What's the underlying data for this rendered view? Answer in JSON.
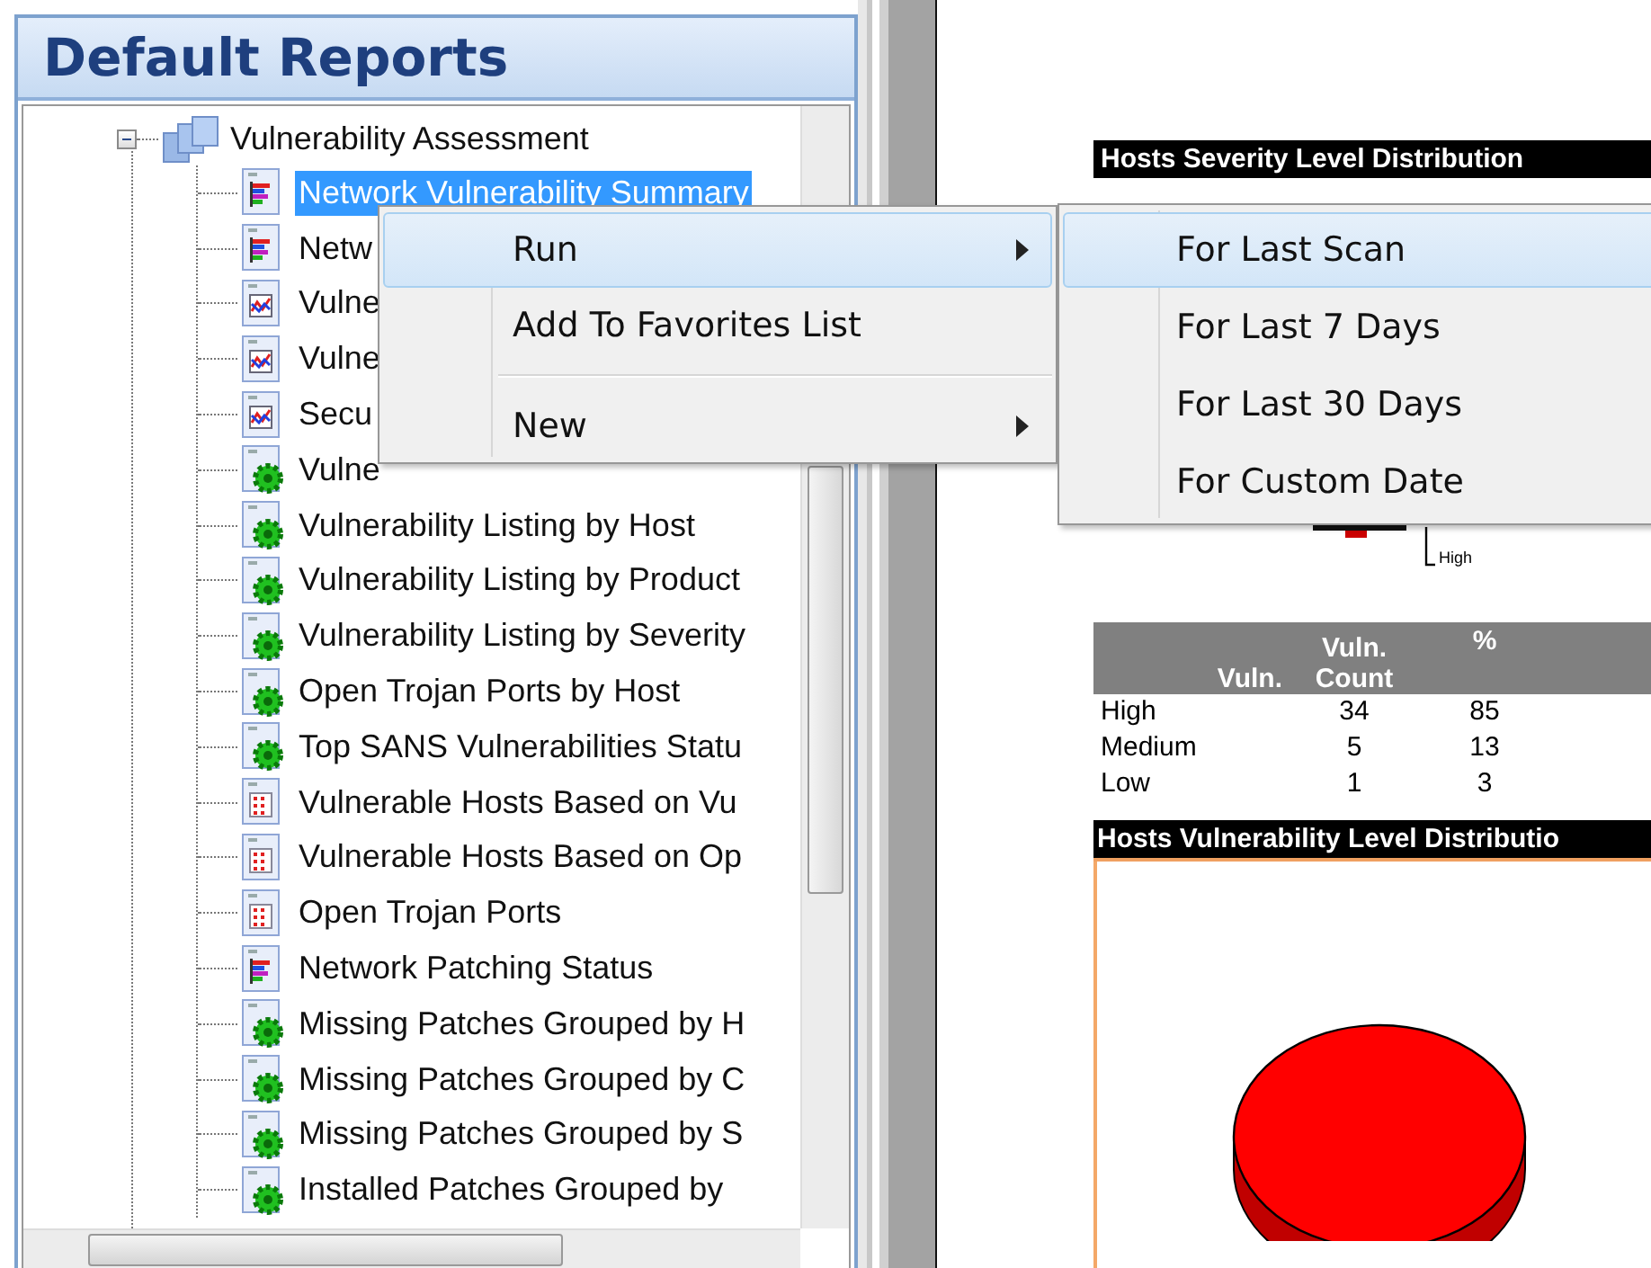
{
  "panel": {
    "title": "Default Reports"
  },
  "tree": {
    "label": "Vulnerability Assessment",
    "expanded": true,
    "children": [
      {
        "label": "Network Vulnerability Summary",
        "kind": "bars",
        "selected": true
      },
      {
        "label": "Netw",
        "kind": "bars",
        "selected": false
      },
      {
        "label": "Vulne",
        "kind": "line",
        "selected": false
      },
      {
        "label": "Vulne",
        "kind": "line",
        "selected": false
      },
      {
        "label": "Secu",
        "kind": "line",
        "selected": false
      },
      {
        "label": "Vulne",
        "kind": "gear",
        "selected": false
      },
      {
        "label": "Vulnerability Listing by Host",
        "kind": "gear",
        "selected": false
      },
      {
        "label": "Vulnerability Listing by Product",
        "kind": "gear",
        "selected": false
      },
      {
        "label": "Vulnerability Listing by Severity",
        "kind": "gear",
        "selected": false
      },
      {
        "label": "Open Trojan Ports by Host",
        "kind": "gear",
        "selected": false
      },
      {
        "label": "Top SANS Vulnerabilities Statu",
        "kind": "gear",
        "selected": false
      },
      {
        "label": "Vulnerable Hosts Based on Vu",
        "kind": "list",
        "selected": false
      },
      {
        "label": "Vulnerable Hosts Based on Op",
        "kind": "list",
        "selected": false
      },
      {
        "label": "Open Trojan Ports",
        "kind": "list",
        "selected": false
      },
      {
        "label": "Network Patching Status",
        "kind": "bars",
        "selected": false
      },
      {
        "label": "Missing Patches Grouped by H",
        "kind": "gear",
        "selected": false
      },
      {
        "label": "Missing Patches Grouped by C",
        "kind": "gear",
        "selected": false
      },
      {
        "label": "Missing Patches Grouped by S",
        "kind": "gear",
        "selected": false
      },
      {
        "label": "Installed Patches Grouped by",
        "kind": "gear",
        "selected": false
      }
    ]
  },
  "context_menu": {
    "items": [
      {
        "kind": "submenu",
        "label": "Run",
        "highlighted": true
      },
      {
        "kind": "item",
        "label": "Add To Favorites List",
        "highlighted": false
      },
      {
        "kind": "separator"
      },
      {
        "kind": "submenu",
        "label": "New",
        "highlighted": false
      }
    ]
  },
  "submenu": {
    "items": [
      {
        "label": "For Last Scan",
        "highlighted": true
      },
      {
        "label": "For Last 7 Days",
        "highlighted": false
      },
      {
        "label": "For Last 30 Days",
        "highlighted": false
      },
      {
        "label": "For Custom Date",
        "highlighted": false
      }
    ]
  },
  "report": {
    "severity_title": "Hosts Severity Level Distribution",
    "pie_label": "High",
    "table": {
      "columns": [
        "Vuln.",
        "Vuln. Count",
        "%"
      ],
      "rows": [
        [
          "High",
          "34",
          "85"
        ],
        [
          "Medium",
          "5",
          "13"
        ],
        [
          "Low",
          "1",
          "3"
        ]
      ]
    },
    "vulnerability_title": "Hosts Vulnerability Level Distributio"
  }
}
